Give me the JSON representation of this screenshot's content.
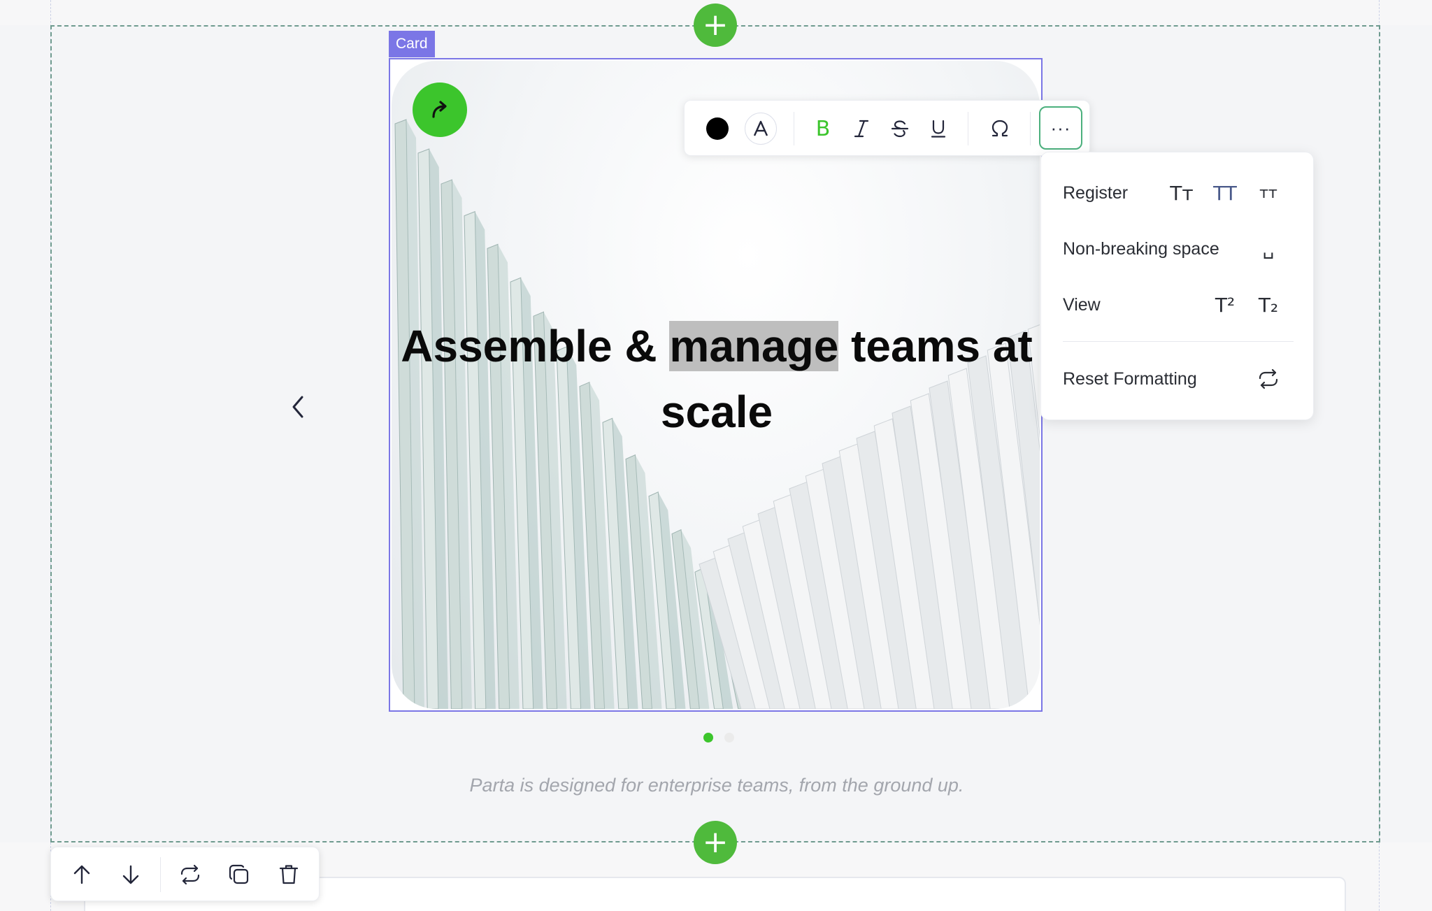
{
  "section": {
    "add_block_top_label": "+",
    "add_block_bottom_label": "+"
  },
  "card": {
    "tag_label": "Card",
    "headline_before": "Assemble & ",
    "headline_selected": "manage",
    "headline_after": " teams at scale",
    "caption": "Parta is designed for enterprise teams, from the ground up.",
    "slides_total": 2,
    "slide_active": 1
  },
  "format_toolbar": {
    "text_color": "#000000",
    "bold_label": "B",
    "more_label": "···",
    "accent_color": "#3cc52c"
  },
  "more_menu": {
    "register_label": "Register",
    "register_options": [
      "Tт",
      "TT",
      "тт"
    ],
    "nbsp_label": "Non-breaking space",
    "nbsp_icon": "␣",
    "view_label": "View",
    "view_options": [
      "T²",
      "T₂"
    ],
    "reset_label": "Reset Formatting"
  },
  "icons": {
    "share": "share-arrow-icon",
    "prev": "chevron-left-icon",
    "move_up": "arrow-up-icon",
    "move_down": "arrow-down-icon",
    "swap": "repeat-icon",
    "duplicate": "copy-icon",
    "delete": "trash-icon"
  }
}
